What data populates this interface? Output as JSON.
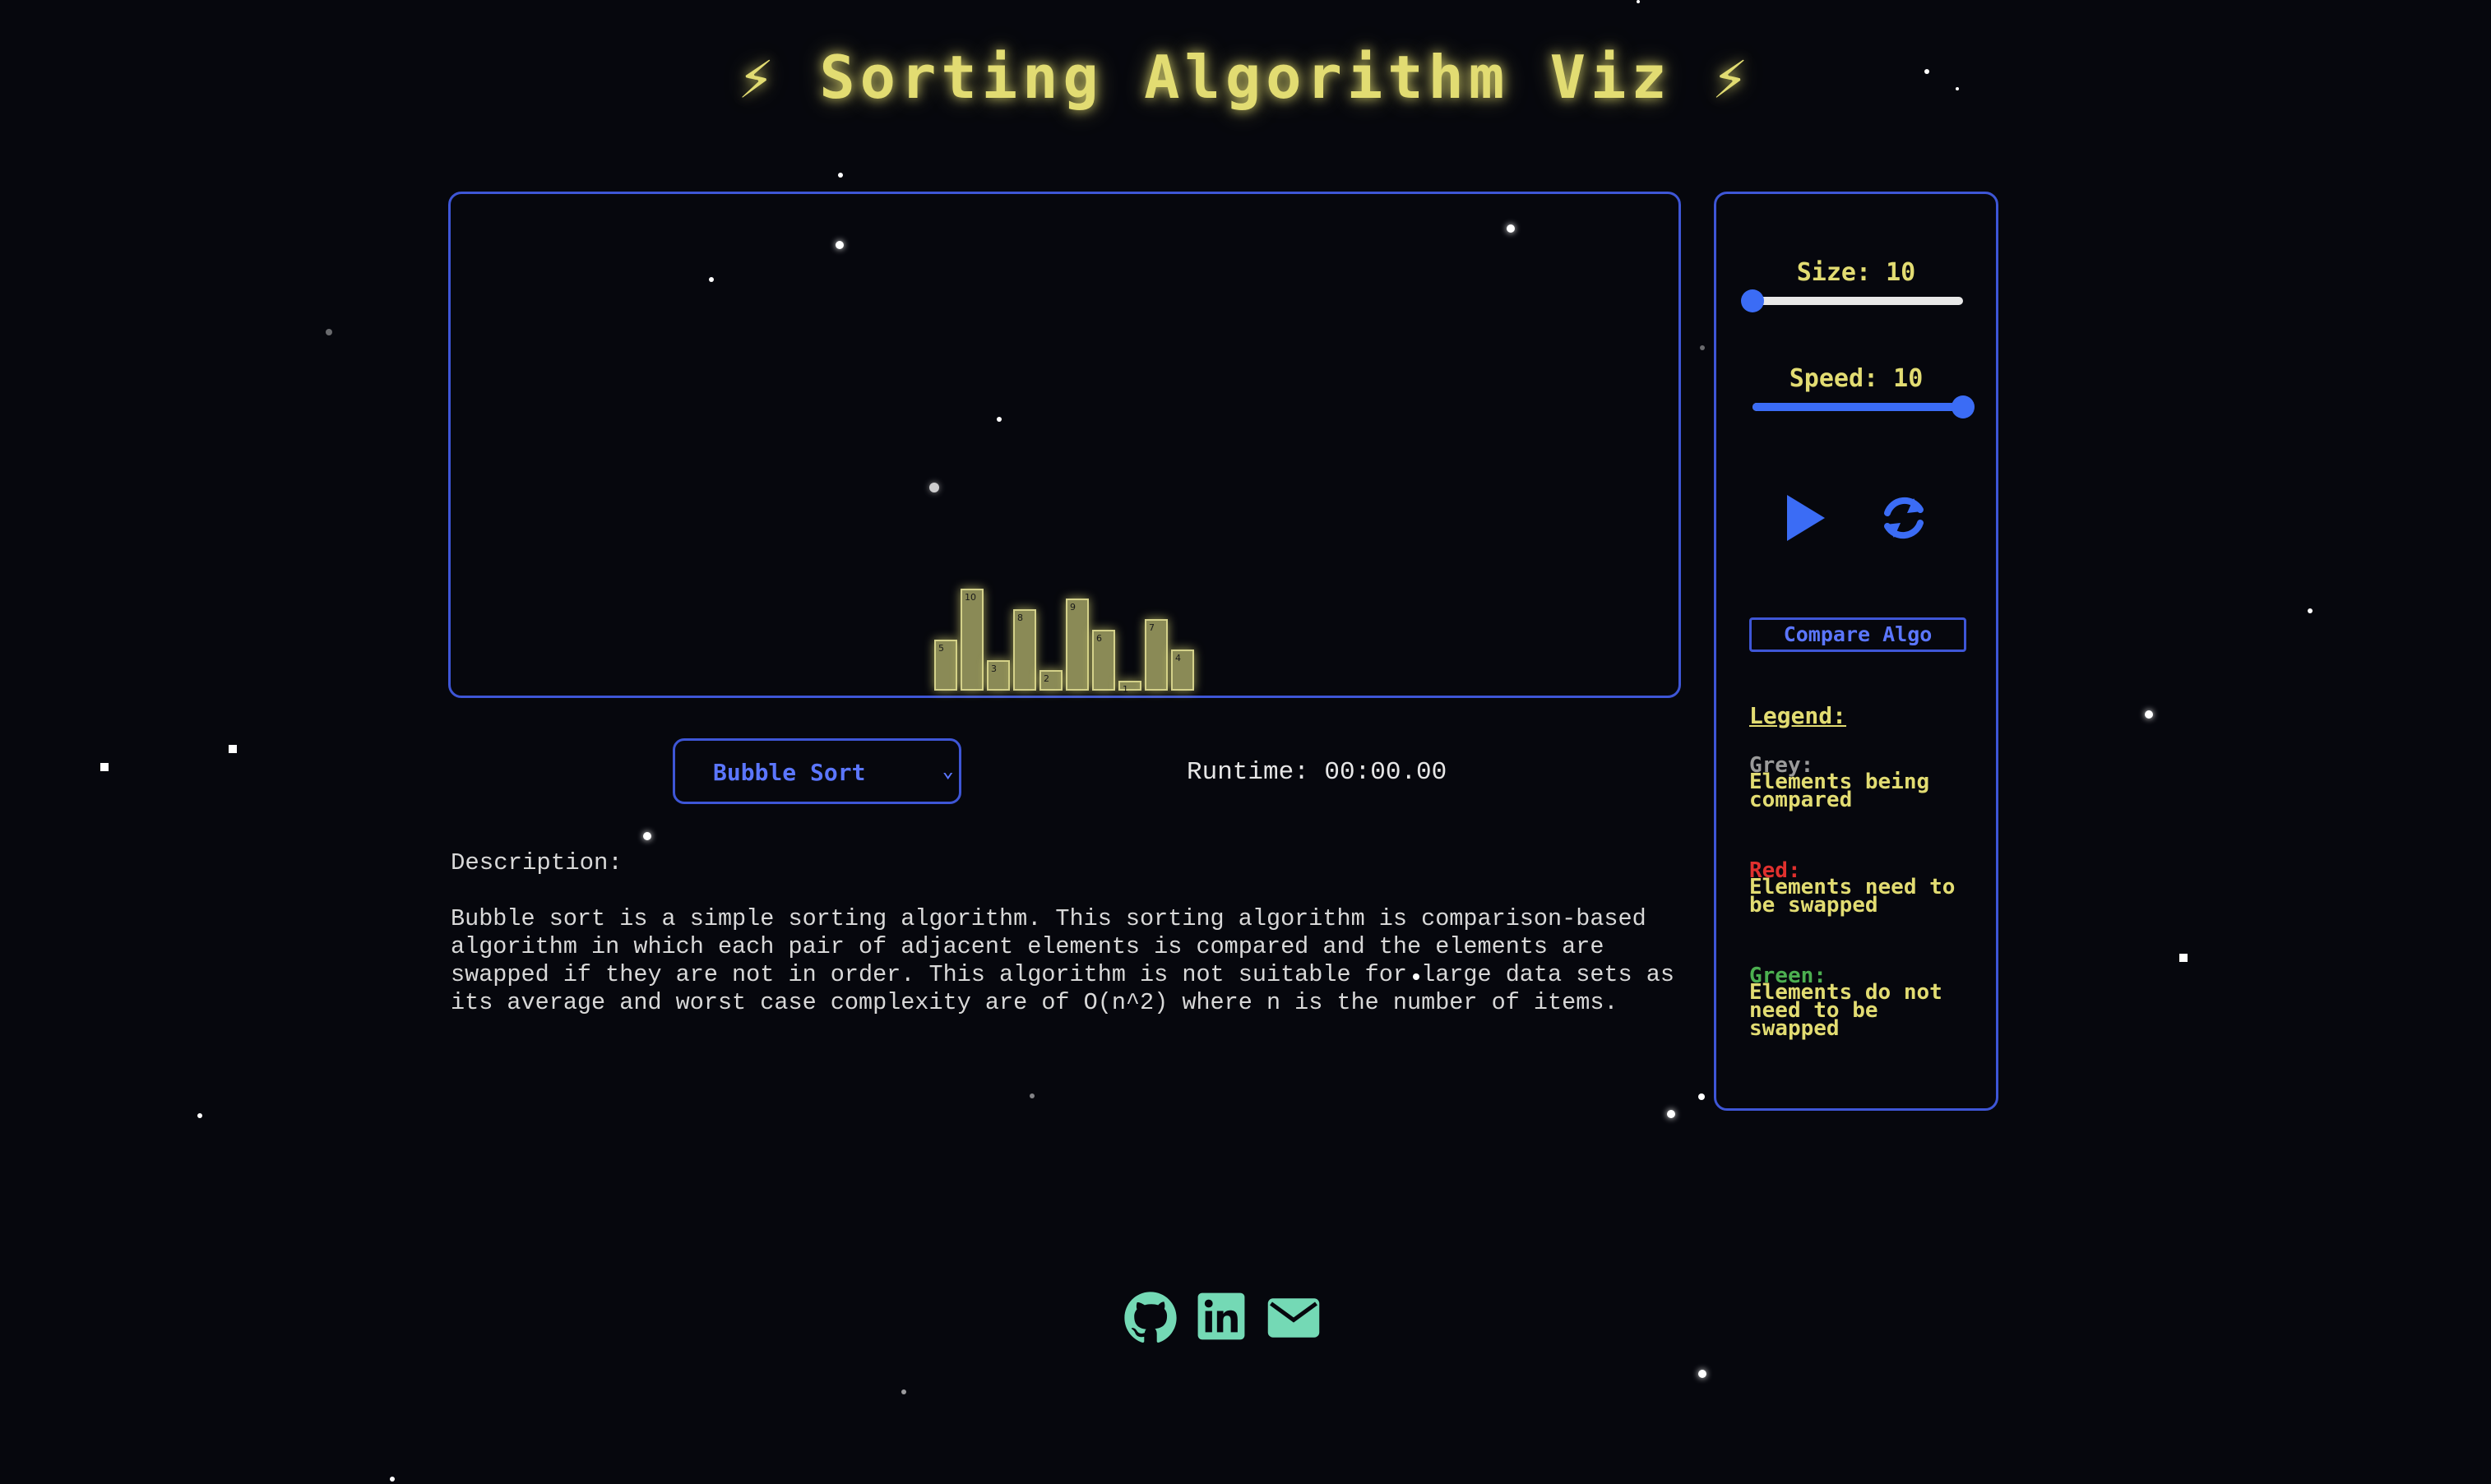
{
  "title": "⚡ Sorting Algorithm Viz ⚡",
  "colors": {
    "accent_yellow": "#e2dc72",
    "accent_blue": "#3e56d6",
    "bar_fill": "#8a8a56",
    "legend_grey": "#9a9a9a",
    "legend_red": "#e0302e",
    "legend_green": "#4caf50",
    "footer_icons": "#74d9b5",
    "background": "#06070d"
  },
  "bars": [
    5,
    10,
    3,
    8,
    2,
    9,
    6,
    1,
    7,
    4
  ],
  "sidebar": {
    "size": {
      "label": "Size:",
      "value": "10",
      "level": 0
    },
    "speed": {
      "label": "Speed:",
      "value": "10",
      "level": 1
    },
    "play_icon": "play-icon",
    "reset_icon": "refresh-icon",
    "compare_label": "Compare Algo",
    "legend_title": "Legend:",
    "legend": [
      {
        "name": "Grey:",
        "desc": "Elements being compared"
      },
      {
        "name": "Red:",
        "desc": "Elements need to be swapped"
      },
      {
        "name": "Green:",
        "desc": "Elements do not need to be swapped"
      }
    ]
  },
  "controls": {
    "algorithm": "Bubble Sort",
    "runtime": "Runtime: 00:00.00"
  },
  "description": {
    "label": "Description:",
    "text": "Bubble sort is a simple sorting algorithm. This sorting algorithm is comparison-based algorithm in which each pair of adjacent elements is compared and the elements are swapped if they are not in order. This algorithm is not suitable for large data sets as its average and worst case complexity are of O(n^2) where n is the number of items."
  },
  "footer": {
    "icons": [
      "github-icon",
      "linkedin-icon",
      "email-icon"
    ]
  }
}
